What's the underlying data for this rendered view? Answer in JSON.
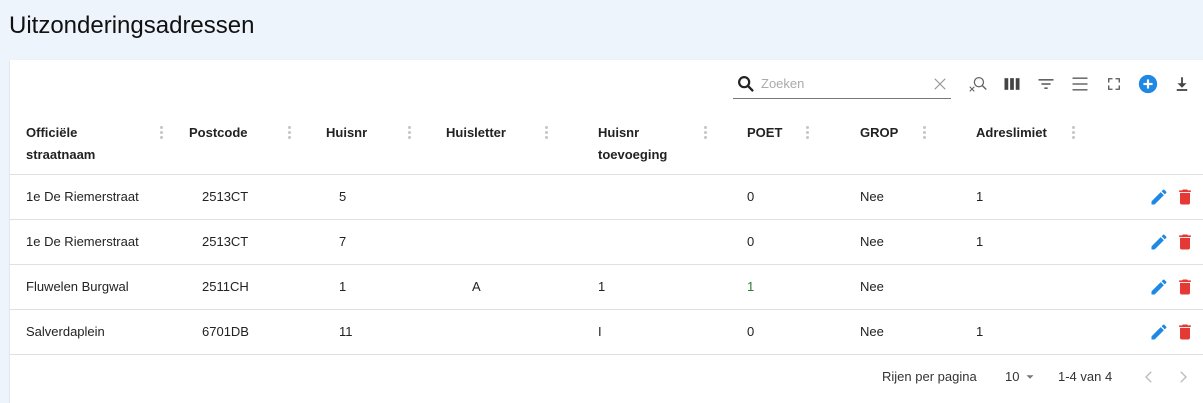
{
  "page": {
    "title": "Uitzonderingsadressen"
  },
  "toolbar": {
    "search_placeholder": "Zoeken",
    "icons": [
      "search-icon",
      "clear-icon",
      "reset-search-icon",
      "columns-icon",
      "filter-icon",
      "density-icon",
      "fullscreen-icon",
      "add-icon",
      "download-icon"
    ],
    "accent": "#1e88e5"
  },
  "table": {
    "columns": [
      {
        "label": "Officiële straatnaam"
      },
      {
        "label": "Postcode"
      },
      {
        "label": "Huisnr"
      },
      {
        "label": "Huisletter"
      },
      {
        "label": "Huisnr toevoeging"
      },
      {
        "label": "POET"
      },
      {
        "label": "GROP"
      },
      {
        "label": "Adreslimiet"
      }
    ],
    "rows": [
      {
        "straat": "1e De Riemerstraat",
        "postcode": "2513CT",
        "huisnr": "5",
        "huisletter": "",
        "toevoeging": "",
        "poet": "0",
        "grop": "Nee",
        "limiet": "1"
      },
      {
        "straat": "1e De Riemerstraat",
        "postcode": "2513CT",
        "huisnr": "7",
        "huisletter": "",
        "toevoeging": "",
        "poet": "0",
        "grop": "Nee",
        "limiet": "1"
      },
      {
        "straat": "Fluwelen Burgwal",
        "postcode": "2511CH",
        "huisnr": "1",
        "huisletter": "A",
        "toevoeging": "1",
        "poet": "1",
        "grop": "Nee",
        "limiet": ""
      },
      {
        "straat": "Salverdaplein",
        "postcode": "6701DB",
        "huisnr": "11",
        "huisletter": "",
        "toevoeging": "I",
        "poet": "0",
        "grop": "Nee",
        "limiet": "1"
      }
    ],
    "edit_color": "#1e88e5",
    "delete_color": "#e53935"
  },
  "footer": {
    "rows_per_page_label": "Rijen per pagina",
    "rows_per_page_value": "10",
    "range_label": "1-4 van 4"
  }
}
